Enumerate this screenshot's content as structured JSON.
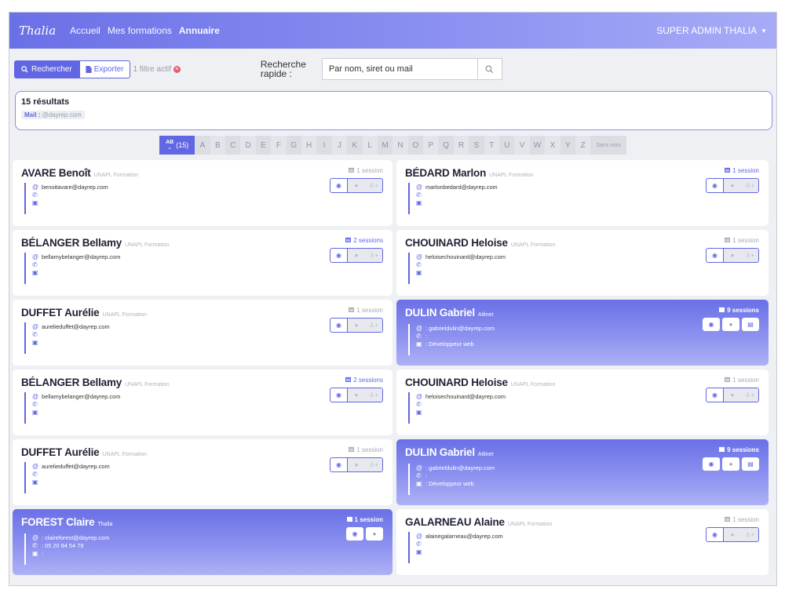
{
  "nav": {
    "brand": "Thalia",
    "links": [
      "Accueil",
      "Mes formations",
      "Annuaire"
    ],
    "active": "Annuaire",
    "user": "SUPER ADMIN THALIA"
  },
  "toolbar": {
    "search_label": "Rechercher",
    "export_label": "Exporter",
    "filter_info": "1 filtre actif",
    "quick_label": "Recherche rapide :",
    "quick_placeholder": "Par nom, siret ou mail"
  },
  "results": {
    "count": "15 résultats",
    "filter_key": "Mail :",
    "filter_value": "@dayrep.com"
  },
  "alphabet": {
    "all_label": "(15)",
    "letters": [
      "A",
      "B",
      "C",
      "D",
      "E",
      "F",
      "G",
      "H",
      "I",
      "J",
      "K",
      "L",
      "M",
      "N",
      "O",
      "P",
      "Q",
      "R",
      "S",
      "T",
      "U",
      "V",
      "W",
      "X",
      "Y",
      "Z"
    ],
    "no_name": "Sans nom"
  },
  "colors": {
    "accent": "#6167e2",
    "highlight_start": "#6a70e6",
    "highlight_end": "#aeb1f5"
  },
  "cards": [
    {
      "name": "AVARE Benoît",
      "org": "UNAPL Formation",
      "email": "benoitavare@dayrep.com",
      "phone": "",
      "job": "",
      "sessions": "1 session",
      "sessions_hot": false,
      "highlight": false
    },
    {
      "name": "BÉDARD Marlon",
      "org": "UNAPL Formation",
      "email": "marlonbedard@dayrep.com",
      "phone": "",
      "job": "",
      "sessions": "1 session",
      "sessions_hot": true,
      "highlight": false
    },
    {
      "name": "BÉLANGER Bellamy",
      "org": "UNAPL Formation",
      "email": "bellamybelanger@dayrep.com",
      "phone": "",
      "job": "",
      "sessions": "2 sessions",
      "sessions_hot": true,
      "highlight": false
    },
    {
      "name": "CHOUINARD Heloise",
      "org": "UNAPL Formation",
      "email": "heloisechouinard@dayrep.com",
      "phone": "",
      "job": "",
      "sessions": "1 session",
      "sessions_hot": false,
      "highlight": false
    },
    {
      "name": "DUFFET Aurélie",
      "org": "UNAPL Formation",
      "email": "aurelieduffet@dayrep.com",
      "phone": "",
      "job": "",
      "sessions": "1 session",
      "sessions_hot": false,
      "highlight": false
    },
    {
      "name": "DULIN Gabriel",
      "org": "Atlinet",
      "email": ": gabrieldulin@dayrep.com",
      "phone": ":",
      "job": ": Développeur web",
      "sessions": "9 sessions",
      "sessions_hot": true,
      "highlight": true
    },
    {
      "name": "BÉLANGER Bellamy",
      "org": "UNAPL Formation",
      "email": "bellamybelanger@dayrep.com",
      "phone": "",
      "job": "",
      "sessions": "2 sessions",
      "sessions_hot": true,
      "highlight": false
    },
    {
      "name": "CHOUINARD Heloise",
      "org": "UNAPL Formation",
      "email": "heloisechouinard@dayrep.com",
      "phone": "",
      "job": "",
      "sessions": "1 session",
      "sessions_hot": false,
      "highlight": false
    },
    {
      "name": "DUFFET Aurélie",
      "org": "UNAPL Formation",
      "email": "aurelieduffet@dayrep.com",
      "phone": "",
      "job": "",
      "sessions": "1 session",
      "sessions_hot": false,
      "highlight": false
    },
    {
      "name": "DULIN Gabriel",
      "org": "Atlinet",
      "email": ": gabrieldulin@dayrep.com",
      "phone": ":",
      "job": ": Développeur web",
      "sessions": "9 sessions",
      "sessions_hot": true,
      "highlight": true
    },
    {
      "name": "FOREST Claire",
      "org": "Thalia",
      "email": ": claireforest@dayrep.com",
      "phone": ": 05 20 84 54 79",
      "job": ":",
      "sessions": "1 session",
      "sessions_hot": true,
      "highlight": true,
      "two_actions": true
    },
    {
      "name": "GALARNEAU Alaine",
      "org": "UNAPL Formation",
      "email": "alainegalarneau@dayrep.com",
      "phone": "",
      "job": "",
      "sessions": "1 session",
      "sessions_hot": false,
      "highlight": false
    }
  ]
}
